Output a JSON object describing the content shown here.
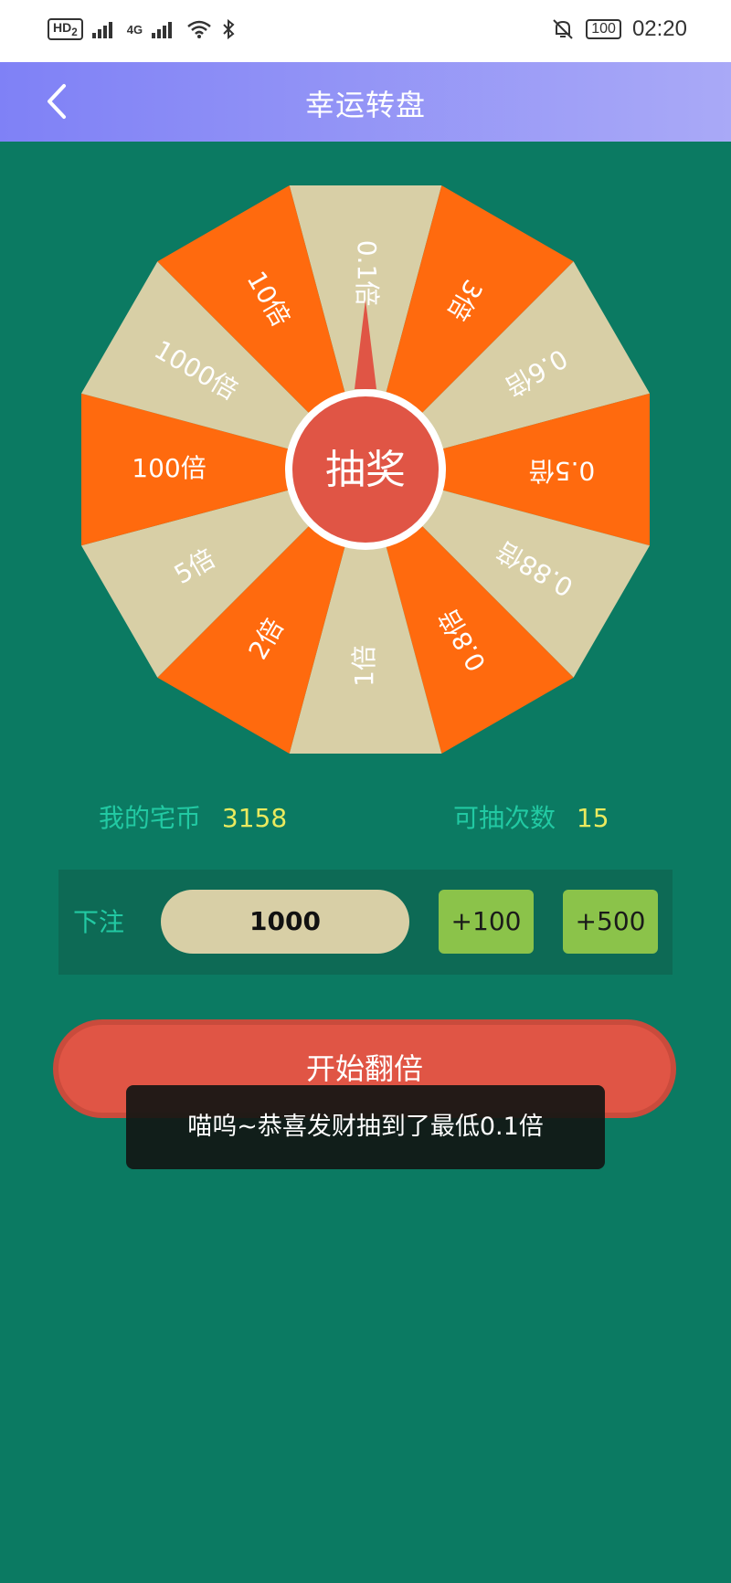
{
  "status_bar": {
    "network_badge": "HD",
    "network_badge_sub": "2",
    "signal_label": "4G",
    "battery": "100",
    "time": "02:20"
  },
  "header": {
    "title": "幸运转盘",
    "back_icon": "chevron-left-icon"
  },
  "wheel": {
    "segments": [
      "0.1倍",
      "3倍",
      "0.6倍",
      "0.5倍",
      "0.88倍",
      "0.8倍",
      "1倍",
      "2倍",
      "5倍",
      "100倍",
      "1000倍",
      "10倍"
    ],
    "colors": {
      "beige": "#d8cfa6",
      "orange": "#ff6a0e",
      "center": "#e05545",
      "text": "#ffffff"
    },
    "center_label": "抽奖"
  },
  "stats": {
    "coins_label": "我的宅币",
    "coins_value": "3158",
    "draws_label": "可抽次数",
    "draws_value": "15"
  },
  "bet": {
    "label": "下注",
    "amount": "1000",
    "add_100": "+100",
    "add_500": "+500"
  },
  "start_button": {
    "label": "开始翻倍"
  },
  "toast": {
    "message": "喵呜~恭喜发财抽到了最低0.1倍"
  }
}
